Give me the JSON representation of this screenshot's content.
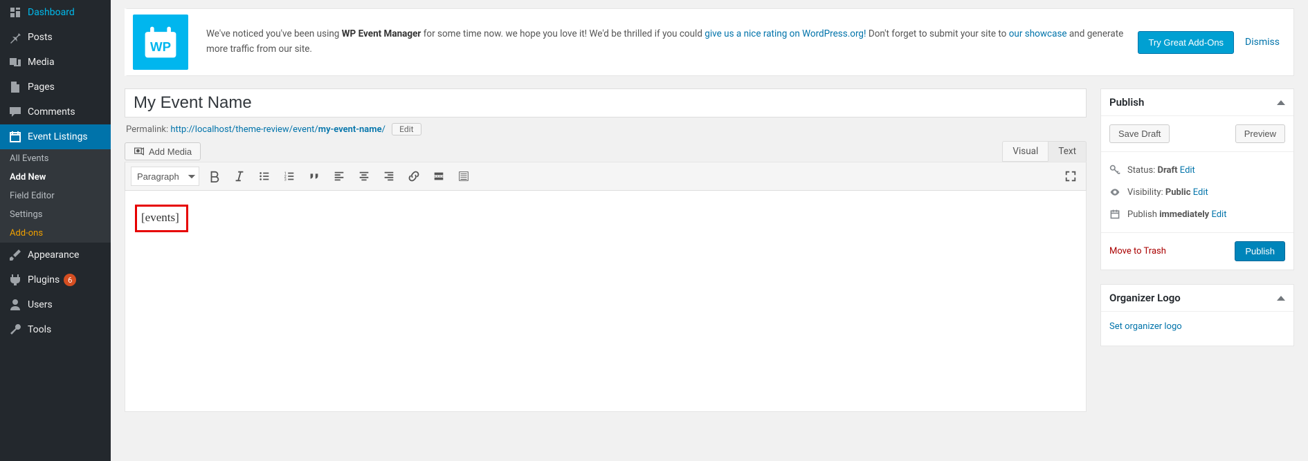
{
  "sidebar": {
    "dashboard": "Dashboard",
    "posts": "Posts",
    "media": "Media",
    "pages": "Pages",
    "comments": "Comments",
    "event_listings": "Event Listings",
    "sub": {
      "all_events": "All Events",
      "add_new": "Add New",
      "field_editor": "Field Editor",
      "settings": "Settings",
      "addons": "Add-ons"
    },
    "appearance": "Appearance",
    "plugins": "Plugins",
    "plugins_badge": "6",
    "users": "Users",
    "tools": "Tools"
  },
  "notice": {
    "text_1": "We've noticed you've been using ",
    "strong_1": "WP Event Manager",
    "text_2": " for some time now. we hope you love it! We'd be thrilled if you could ",
    "link_1": "give us a nice rating on WordPress.org!",
    "text_3": " Don't forget to submit your site to ",
    "link_2": "our showcase",
    "text_4": " and generate more traffic from our site.",
    "button": "Try Great Add-Ons",
    "dismiss": "Dismiss"
  },
  "post": {
    "title": "My Event Name",
    "permalink_label": "Permalink: ",
    "permalink_base": "http://localhost/theme-review/event/",
    "permalink_slug": "my-event-name",
    "permalink_trail": "/",
    "permalink_edit": "Edit"
  },
  "editor": {
    "add_media": "Add Media",
    "tab_visual": "Visual",
    "tab_text": "Text",
    "format_select": "Paragraph",
    "content": "[events]"
  },
  "publish": {
    "title": "Publish",
    "save_draft": "Save Draft",
    "preview": "Preview",
    "status_label": "Status: ",
    "status_value": "Draft",
    "visibility_label": "Visibility: ",
    "visibility_value": "Public",
    "schedule_label": "Publish ",
    "schedule_value": "immediately",
    "edit": "Edit",
    "trash": "Move to Trash",
    "publish_btn": "Publish"
  },
  "organizer": {
    "title": "Organizer Logo",
    "link": "Set organizer logo"
  }
}
